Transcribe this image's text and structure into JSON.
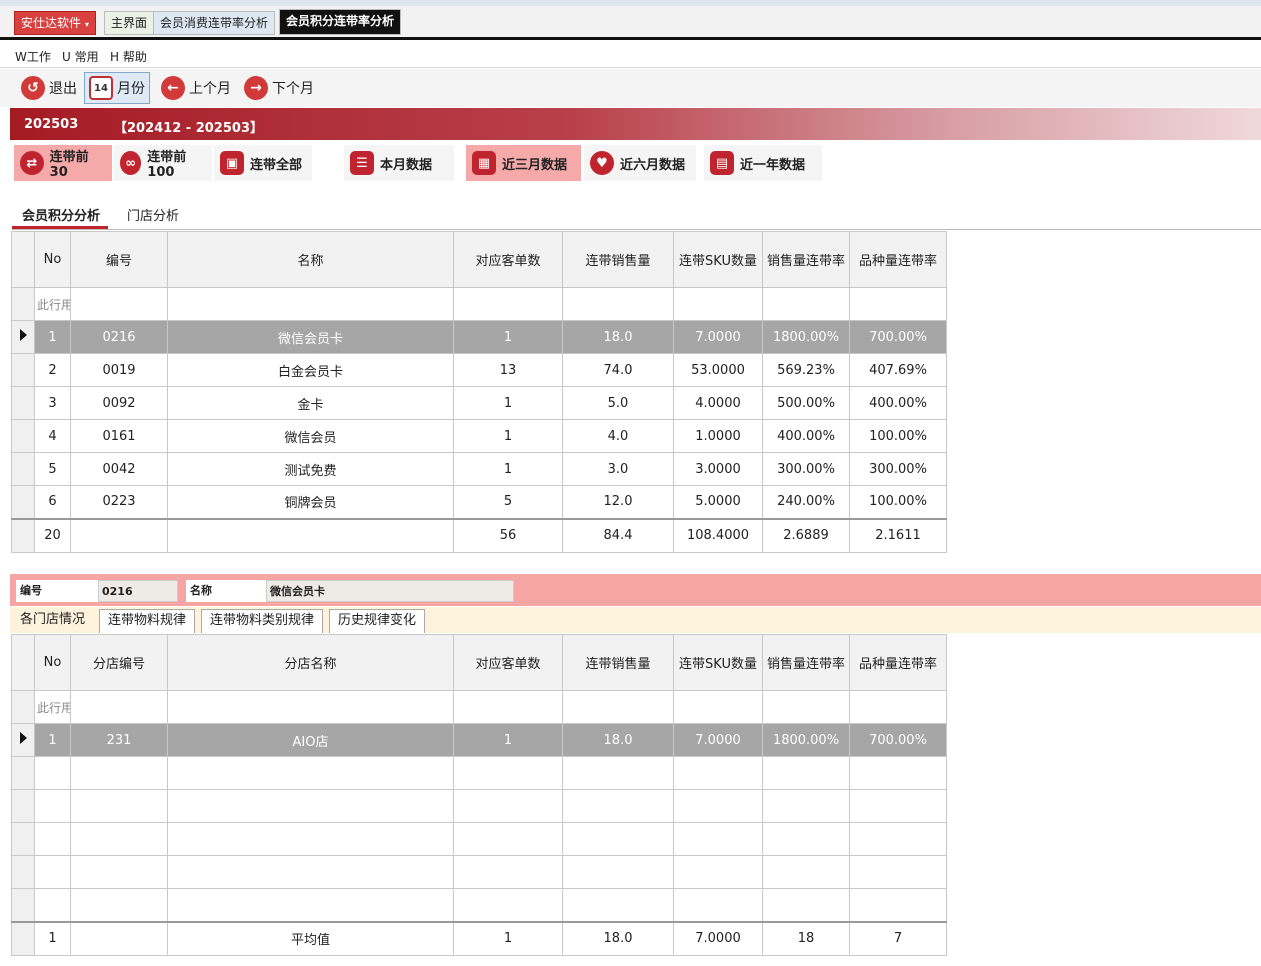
{
  "app": {
    "menu_label": "安仕达软件",
    "tabs": [
      {
        "label": "主界面"
      },
      {
        "label": "会员消费连带率分析"
      },
      {
        "label": "会员积分连带率分析"
      }
    ]
  },
  "menubar": {
    "items": [
      "W工作",
      "U 常用",
      "H 帮助"
    ]
  },
  "toolbar": {
    "exit": "退出",
    "month": "月份",
    "calendar_day": "14",
    "prev_month": "上个月",
    "next_month": "下个月"
  },
  "period": {
    "current": "202503",
    "range": "【202412 - 202503】"
  },
  "filters": [
    {
      "label": "连带前30",
      "icon": "share-icon",
      "active": true
    },
    {
      "label": "连带前100",
      "icon": "link-icon",
      "active": false
    },
    {
      "label": "连带全部",
      "icon": "chart-icon",
      "active": false
    },
    {
      "label": "本月数据",
      "icon": "document-icon",
      "active": false
    },
    {
      "label": "近三月数据",
      "icon": "calendar-icon",
      "active": true
    },
    {
      "label": "近六月数据",
      "icon": "heart-icon",
      "active": false
    },
    {
      "label": "近一年数据",
      "icon": "screen-icon",
      "active": false
    }
  ],
  "subtabs": [
    "会员积分分析",
    "门店分析"
  ],
  "main_grid": {
    "headers": [
      "No",
      "编号",
      "名称",
      "对应客单数",
      "连带销售量",
      "连带SKU数量",
      "销售量连带率",
      "品种量连带率"
    ],
    "filter_row": "此行用",
    "rows": [
      [
        "1",
        "0216",
        "微信会员卡",
        "1",
        "18.0",
        "7.0000",
        "1800.00%",
        "700.00%"
      ],
      [
        "2",
        "0019",
        "白金会员卡",
        "13",
        "74.0",
        "53.0000",
        "569.23%",
        "407.69%"
      ],
      [
        "3",
        "0092",
        "金卡",
        "1",
        "5.0",
        "4.0000",
        "500.00%",
        "400.00%"
      ],
      [
        "4",
        "0161",
        "微信会员",
        "1",
        "4.0",
        "1.0000",
        "400.00%",
        "100.00%"
      ],
      [
        "5",
        "0042",
        "测试免费",
        "1",
        "3.0",
        "3.0000",
        "300.00%",
        "300.00%"
      ],
      [
        "6",
        "0223",
        "铜牌会员",
        "5",
        "12.0",
        "5.0000",
        "240.00%",
        "100.00%"
      ]
    ],
    "total": [
      "20",
      "",
      "",
      "56",
      "84.4",
      "108.4000",
      "2.6889",
      "2.1611"
    ]
  },
  "detail": {
    "code_label": "编号",
    "code_value": "0216",
    "name_label": "名称",
    "name_value": "微信会员卡"
  },
  "bottom_tabs": [
    "各门店情况",
    "连带物料规律",
    "连带物料类别规律",
    "历史规律变化"
  ],
  "store_grid": {
    "headers": [
      "No",
      "分店编号",
      "分店名称",
      "对应客单数",
      "连带销售量",
      "连带SKU数量",
      "销售量连带率",
      "品种量连带率"
    ],
    "filter_row": "此行用",
    "rows": [
      [
        "1",
        "231",
        "AIO店",
        "1",
        "18.0",
        "7.0000",
        "1800.00%",
        "700.00%"
      ]
    ],
    "total": [
      "1",
      "",
      "平均值",
      "1",
      "18.0",
      "7.0000",
      "18",
      "7"
    ]
  },
  "colors": {
    "accent_red": "#c0242e",
    "selected_row": "#a6a6a6",
    "active_filter": "#f6a9a9",
    "detail_bar": "#f6a5a5"
  }
}
